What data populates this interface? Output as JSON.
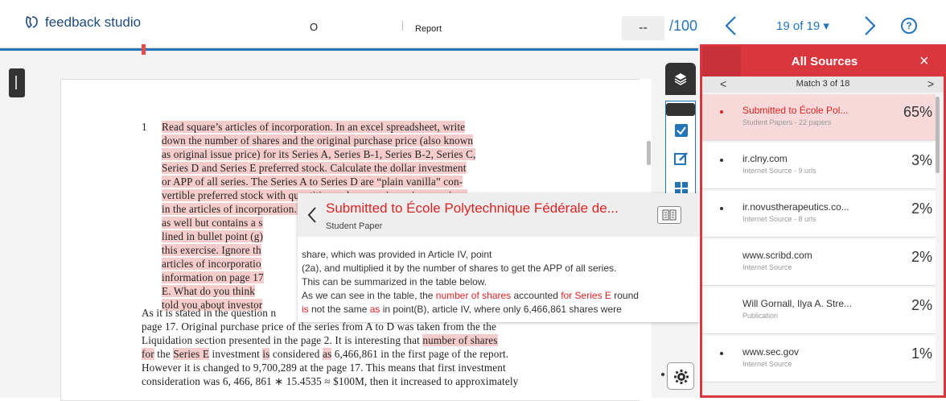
{
  "app": {
    "name": "feedback studio"
  },
  "header": {
    "doc_title": "O",
    "doc_report": "Report",
    "score_value": "--",
    "score_total": "/100",
    "page_count": "19 of 19 ▾",
    "help": "?"
  },
  "document": {
    "footnote_num": "1",
    "lines": [
      "Read square’s articles of incorporation.  In an excel spreadsheet, write",
      "down the number of shares and the original purchase price (also known",
      "as original issue price) for its Series A, Series B-1, Series B-2, Series C,",
      "Series D and Series E preferred stock.  Calculate the dollar investment",
      "or APP of all series.  The Series A to Series D are “plain vanilla” con-",
      "vertible preferred stock with quantities and conversion prices as given",
      "in the articles of incorporation.  The Series E is convertible preferred",
      "as well but contains a s",
      "lined in bullet point (g)",
      "this exercise.  Ignore th",
      "articles of incorporatio",
      "information on page 17",
      "E. What do you think",
      "told you about investor"
    ],
    "para2_lines": [
      "As it is stated in the question n",
      "page 17.  Original purchase price of the series from A to D was ta",
      "ken from the the",
      "Liquidation section presented in the page 2.  It is interesting that ",
      "number of shares",
      "for",
      " the ",
      "Series E",
      " investment ",
      "is",
      " considered ",
      "as",
      " 6,466,861 in the first page of the report.",
      "However it is changed to 9,700,289 at the page 17.  This means that first investment",
      "consideration was 6, 466, 861 ∗ 15.4535 ≈ $100M, then it increased to approximately"
    ]
  },
  "popup": {
    "title": "Submitted to École Polytechnique Fédérale de...",
    "subtitle": "Student Paper",
    "body": [
      "share, which was provided in Article IV, point",
      "(2a), and multiplied it by the number of shares to get the APP of all series.",
      "This can be summarized in the table below.",
      "As we can see in the table, the ",
      "number of shares",
      " accounted ",
      "for Series E",
      " round",
      "is",
      " not the same ",
      "as",
      " in point(B), article IV, where only 6,466,861 shares were"
    ]
  },
  "sources": {
    "title": "All Sources",
    "close": "×",
    "match": "Match 3 of 18",
    "items": [
      {
        "name": "Submitted to École Pol...",
        "sub": "Student Papers - 22 papers",
        "pct": "65%"
      },
      {
        "name": "ir.clny.com",
        "sub": "Internet Source - 9 urls",
        "pct": "3%"
      },
      {
        "name": "ir.novustherapeutics.co...",
        "sub": "Internet Source - 8 urls",
        "pct": "2%"
      },
      {
        "name": "www.scribd.com",
        "sub": "Internet Source",
        "pct": "2%"
      },
      {
        "name": "Will Gornall, Ilya A. Stre...",
        "sub": "Publication",
        "pct": "2%"
      },
      {
        "name": "www.sec.gov",
        "sub": "Internet Source",
        "pct": "1%"
      }
    ]
  },
  "colors": {
    "accent": "#2474b8",
    "match_red": "#d9363e",
    "highlight": "#f5cccc"
  }
}
